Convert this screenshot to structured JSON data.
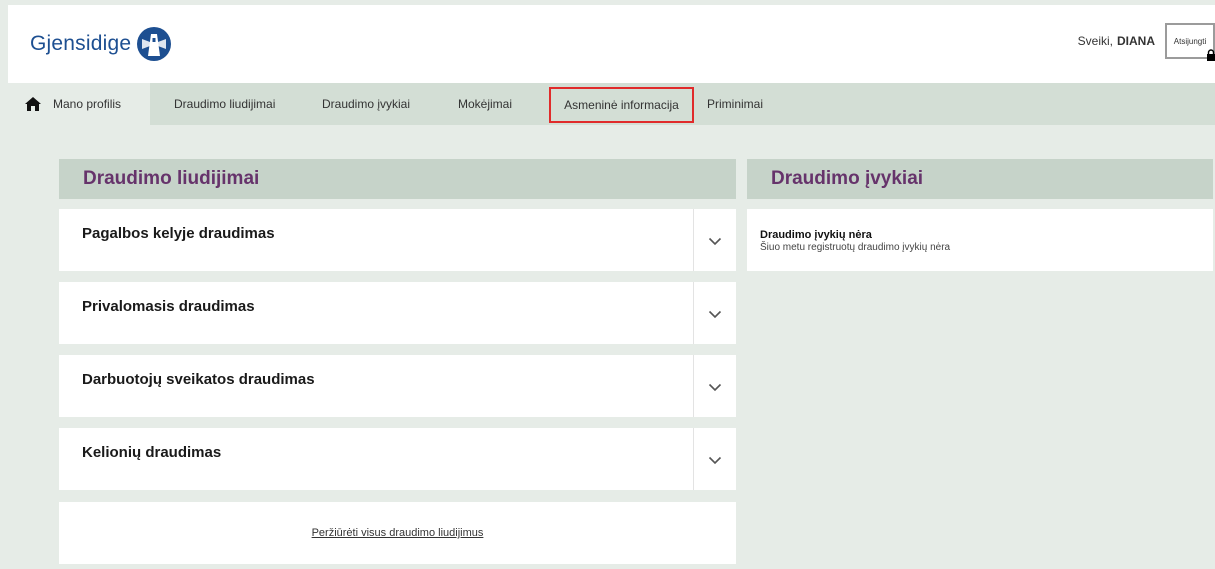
{
  "header": {
    "logo_text": "Gjensidige",
    "greeting": "Sveiki,",
    "user_name": "DIANA",
    "logout_label": "Atsijungti"
  },
  "nav": {
    "items": [
      {
        "label": "Mano profilis",
        "icon": "home-icon",
        "active": true
      },
      {
        "label": "Draudimo liudijimai"
      },
      {
        "label": "Draudimo įvykiai"
      },
      {
        "label": "Mokėjimai"
      },
      {
        "label": "Asmeninė informacija",
        "highlighted": true
      },
      {
        "label": "Priminimai"
      }
    ]
  },
  "policies": {
    "title": "Draudimo liudijimai",
    "items": [
      {
        "title": "Pagalbos kelyje draudimas"
      },
      {
        "title": "Privalomasis draudimas"
      },
      {
        "title": "Darbuotojų sveikatos draudimas"
      },
      {
        "title": "Kelionių draudimas"
      }
    ],
    "view_all_label": "Peržiūrėti visus draudimo liudijimus"
  },
  "events": {
    "title": "Draudimo įvykiai",
    "empty_title": "Draudimo įvykių nėra",
    "empty_text": "Šiuo metu registruotų draudimo įvykių nėra"
  },
  "colors": {
    "brand_blue": "#1d4f91",
    "heading_purple": "#66336b",
    "nav_bg": "#d3ded5",
    "card_header_bg": "#c6d3c9",
    "highlight_red": "#e02b2b"
  }
}
